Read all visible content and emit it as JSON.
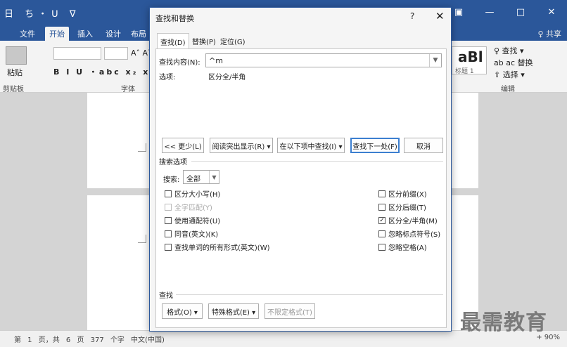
{
  "word": {
    "quick_access": "日 ち・ᑌ ᐁ",
    "window_controls": [
      "▣",
      "—",
      "□",
      "✕"
    ],
    "tabs": [
      "文件",
      "开始",
      "插入",
      "设计",
      "布局"
    ],
    "share": "♀ 共享",
    "ribbon": {
      "paste": "粘贴",
      "clipboard": "剪贴板",
      "font_group": "字体",
      "grow_font": "A˄ A˅",
      "format_row": "B I U ・abc x₂ x²  A",
      "styles_preview": "aBl",
      "styles_sub": "标题 1",
      "find": "♀ 查找 ▾",
      "replace": "ab ac 替换",
      "select": "⇧ 选择 ▾",
      "edit_group": "编辑"
    },
    "status": "第 1 页，共 6 页    377 个字    中文(中国)",
    "zoom": "+ 90%"
  },
  "dialog": {
    "title": "查找和替换",
    "help": "?",
    "close": "✕",
    "tabs": [
      "查找(D)",
      "替换(P)",
      "定位(G)"
    ],
    "find_label": "查找内容(N):",
    "find_value": "^m",
    "options_label": "选项:",
    "options_value": "区分全/半角",
    "buttons": {
      "less": "<< 更少(L)",
      "reading_highlight": "阅读突出显示(R) ▾",
      "find_in": "在以下项中查找(I) ▾",
      "find_next": "查找下一处(F)",
      "cancel": "取消"
    },
    "search_options_title": "搜索选项",
    "search_label": "搜索:",
    "search_value": "全部",
    "checkboxes_left": [
      {
        "label": "区分大小写(H)",
        "checked": false,
        "disabled": false
      },
      {
        "label": "全字匹配(Y)",
        "checked": false,
        "disabled": true
      },
      {
        "label": "使用通配符(U)",
        "checked": false,
        "disabled": false
      },
      {
        "label": "同音(英文)(K)",
        "checked": false,
        "disabled": false
      },
      {
        "label": "查找单词的所有形式(英文)(W)",
        "checked": false,
        "disabled": false
      }
    ],
    "checkboxes_right": [
      {
        "label": "区分前缀(X)",
        "checked": false
      },
      {
        "label": "区分后缀(T)",
        "checked": false
      },
      {
        "label": "区分全/半角(M)",
        "checked": true
      },
      {
        "label": "忽略标点符号(S)",
        "checked": false
      },
      {
        "label": "忽略空格(A)",
        "checked": false
      }
    ],
    "find_section_title": "查找",
    "bottom_buttons": {
      "format": "格式(O) ▾",
      "special": "特殊格式(E) ▾",
      "no_format": "不限定格式(T)"
    }
  },
  "watermark": "最需教育",
  "colors": {
    "accent": "#2b579a",
    "primary_border": "#3c7fd0"
  }
}
